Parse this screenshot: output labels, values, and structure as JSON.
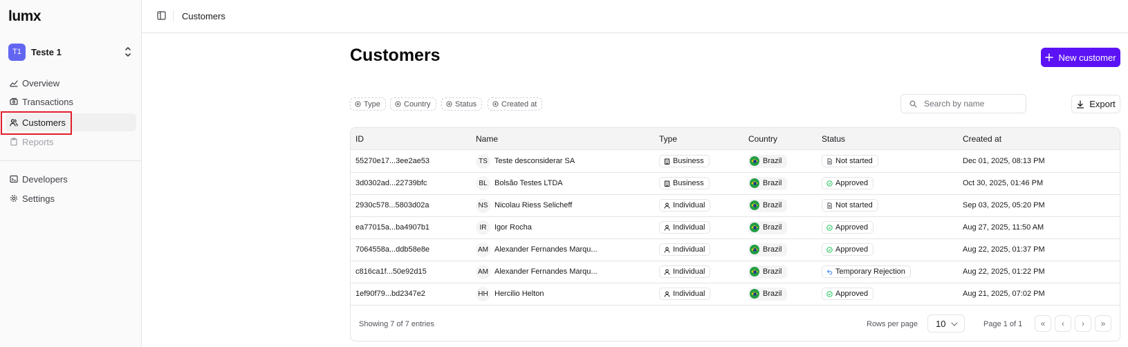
{
  "app": {
    "logo": "lumx"
  },
  "workspace": {
    "initials": "T1",
    "name": "Teste 1"
  },
  "nav": {
    "overview": "Overview",
    "transactions": "Transactions",
    "customers": "Customers",
    "reports": "Reports",
    "developers": "Developers",
    "settings": "Settings"
  },
  "topbar": {
    "breadcrumb": "Customers"
  },
  "page": {
    "title": "Customers",
    "new_button": "New customer"
  },
  "filters": [
    "Type",
    "Country",
    "Status",
    "Created at"
  ],
  "search": {
    "placeholder": "Search by name"
  },
  "export_label": "Export",
  "table": {
    "columns": [
      "ID",
      "Name",
      "Type",
      "Country",
      "Status",
      "Created at"
    ],
    "rows": [
      {
        "id": "55270e17...3ee2ae53",
        "initials": "TS",
        "name": "Teste desconsiderar SA",
        "type": "Business",
        "country": "Brazil",
        "status": "Not started",
        "created": "Dec 01, 2025, 08:13 PM"
      },
      {
        "id": "3d0302ad...22739bfc",
        "initials": "BL",
        "name": "Bolsão Testes LTDA",
        "type": "Business",
        "country": "Brazil",
        "status": "Approved",
        "created": "Oct 30, 2025, 01:46 PM"
      },
      {
        "id": "2930c578...5803d02a",
        "initials": "NS",
        "name": "Nicolau Riess Selicheff",
        "type": "Individual",
        "country": "Brazil",
        "status": "Not started",
        "created": "Sep 03, 2025, 05:20 PM"
      },
      {
        "id": "ea77015a...ba4907b1",
        "initials": "IR",
        "name": "Igor Rocha",
        "type": "Individual",
        "country": "Brazil",
        "status": "Approved",
        "created": "Aug 27, 2025, 11:50 AM"
      },
      {
        "id": "7064558a...ddb58e8e",
        "initials": "AM",
        "name": "Alexander Fernandes Marqu...",
        "type": "Individual",
        "country": "Brazil",
        "status": "Approved",
        "created": "Aug 22, 2025, 01:37 PM"
      },
      {
        "id": "c816ca1f...50e92d15",
        "initials": "AM",
        "name": "Alexander Fernandes Marqu...",
        "type": "Individual",
        "country": "Brazil",
        "status": "Temporary Rejection",
        "created": "Aug 22, 2025, 01:22 PM"
      },
      {
        "id": "1ef90f79...bd2347e2",
        "initials": "HH",
        "name": "Hercilio Helton",
        "type": "Individual",
        "country": "Brazil",
        "status": "Approved",
        "created": "Aug 21, 2025, 07:02 PM"
      }
    ]
  },
  "footer": {
    "showing": "Showing 7 of 7 entries",
    "rows_per_page_label": "Rows per page",
    "rows_per_page_value": "10",
    "page_info": "Page 1 of 1",
    "first": "«",
    "prev": "‹",
    "next": "›",
    "last": "»"
  },
  "colors": {
    "accent": "#5b13f5",
    "approved": "#22c55e",
    "highlight": "#e11d2a"
  }
}
